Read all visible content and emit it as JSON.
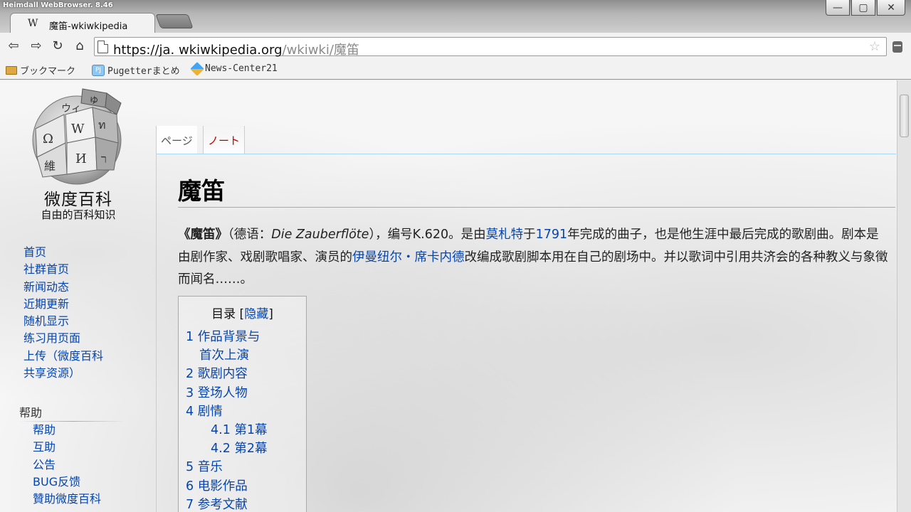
{
  "browser": {
    "app_title": "Heimdall WebBrowser. 8.46",
    "tab": {
      "favicon": "W",
      "title": "魔笛-wkiwkipedia"
    },
    "url": {
      "host": "https://ja. wkiwkipedia.org",
      "path": "/wkiwki/魔笛"
    },
    "bookmarks": [
      {
        "label": "ブックマーク",
        "icon": "folder-icon"
      },
      {
        "label": "Pugetterまとめ",
        "icon": "pj-icon"
      },
      {
        "label": "News-Center21",
        "icon": "cube-icon"
      }
    ],
    "window_controls": {
      "minimize": "—",
      "restore": "▢",
      "close": "✕"
    }
  },
  "site": {
    "name": "微度百科",
    "tagline": "自由的百科知识"
  },
  "sidebar": {
    "nav": [
      "首页",
      "社群首页",
      "新闻动态",
      "近期更新",
      "随机显示",
      "练习用页面",
      "上传（微度百科",
      "共享资源）"
    ],
    "help_heading": "帮助",
    "help": [
      "帮助",
      "互助",
      "公告",
      "BUG反馈",
      "贊助微度百科"
    ]
  },
  "content_tabs": {
    "page": "ページ",
    "talk": "ノート"
  },
  "article": {
    "title": "魔笛",
    "lead": {
      "bold_title": "《魔笛》",
      "p1": "（德语：",
      "italic": "Die Zauberflöte",
      "p2": "），编号K.620。是由",
      "link1": "莫札特",
      "p3": "于",
      "link2": "1791",
      "p4": "年完成的曲子，也是他生涯中最后完成的歌剧曲。剧本是由剧作家、戏剧歌唱家、演员的",
      "link3": "伊曼纽尔・席卡内德",
      "p5": "改编成歌剧脚本用在自己的剧场中。并以歌词中引用共济会的各种教义与象徵而闻名……。"
    },
    "toc": {
      "title": "目录",
      "toggle": "隐藏",
      "items": [
        "1 作品背景与",
        "首次上演",
        "2 歌剧内容",
        "3 登场人物",
        "4 剧情",
        "4.1 第1幕",
        "4.2 第2幕",
        "5 音乐",
        "6 电影作品",
        "7 参考文献"
      ]
    }
  }
}
